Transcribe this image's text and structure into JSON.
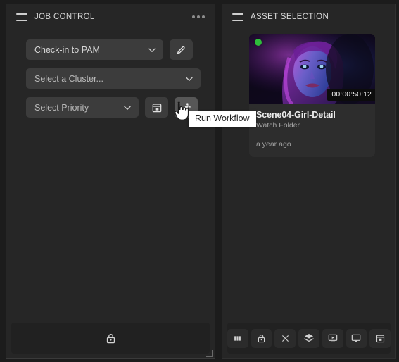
{
  "job_panel": {
    "title": "JOB CONTROL",
    "menu_icon": "more-horizontal-icon",
    "grip_icon": "drag-handle-icon",
    "controls": {
      "workflow_select": {
        "value": "Check-in to PAM",
        "icon": "chevron-down-icon"
      },
      "edit_button": {
        "icon": "pencil-icon",
        "label": "Edit"
      },
      "cluster_select": {
        "placeholder": "Select a Cluster...",
        "icon": "chevron-down-icon"
      },
      "priority_select": {
        "placeholder": "Select Priority",
        "icon": "chevron-down-icon"
      },
      "schedule_button": {
        "icon": "calendar-icon",
        "label": "Schedule"
      },
      "run_button": {
        "icon": "running-person-icon",
        "label": "Run Workflow"
      }
    },
    "footer": {
      "lock_button": {
        "icon": "lock-icon",
        "label": "Lock"
      }
    }
  },
  "asset_panel": {
    "title": "ASSET SELECTION",
    "grip_icon": "drag-handle-icon",
    "asset": {
      "status": "online",
      "status_color": "#2ebd3b",
      "timecode": "00:00:50:12",
      "name": "Scene04-Girl-Detail",
      "source": "Watch Folder",
      "modified": "a year ago"
    },
    "toolbar": [
      {
        "icon": "columns-icon",
        "label": "Columns"
      },
      {
        "icon": "lock-icon",
        "label": "Lock"
      },
      {
        "icon": "close-icon",
        "label": "Close"
      },
      {
        "icon": "layers-icon",
        "label": "Layers"
      },
      {
        "icon": "media-player-icon",
        "label": "Player"
      },
      {
        "icon": "cast-screen-icon",
        "label": "Cast"
      },
      {
        "icon": "calendar-icon",
        "label": "Calendar"
      }
    ]
  },
  "tooltip": {
    "text": "Run Workflow"
  },
  "cursor": {
    "type": "pointing-hand-cursor"
  }
}
